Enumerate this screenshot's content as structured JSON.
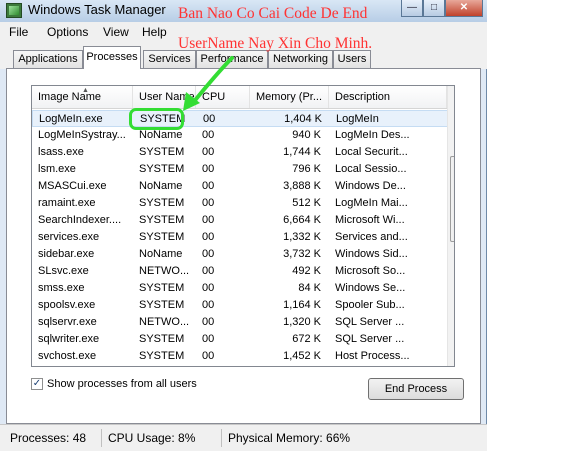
{
  "window": {
    "title": "Windows Task Manager",
    "buttons": [
      "—",
      "□",
      "✕"
    ]
  },
  "menu": [
    "File",
    "Options",
    "View",
    "Help"
  ],
  "tabs": [
    "Applications",
    "Processes",
    "Services",
    "Performance",
    "Networking",
    "Users"
  ],
  "columns": [
    "Image Name",
    "User Name",
    "CPU",
    "Memory (Pr...",
    "Description"
  ],
  "rows": [
    {
      "name": "LogMeIn.exe",
      "user": "SYSTEM",
      "cpu": "00",
      "mem": "1,404 K",
      "desc": "LogMeIn"
    },
    {
      "name": "LogMeInSystray...",
      "user": "NoName",
      "cpu": "00",
      "mem": "940 K",
      "desc": "LogMeIn Des..."
    },
    {
      "name": "lsass.exe",
      "user": "SYSTEM",
      "cpu": "00",
      "mem": "1,744 K",
      "desc": "Local Securit..."
    },
    {
      "name": "lsm.exe",
      "user": "SYSTEM",
      "cpu": "00",
      "mem": "796 K",
      "desc": "Local Sessio..."
    },
    {
      "name": "MSASCui.exe",
      "user": "NoName",
      "cpu": "00",
      "mem": "3,888 K",
      "desc": "Windows De..."
    },
    {
      "name": "ramaint.exe",
      "user": "SYSTEM",
      "cpu": "00",
      "mem": "512 K",
      "desc": "LogMeIn Mai..."
    },
    {
      "name": "SearchIndexer....",
      "user": "SYSTEM",
      "cpu": "00",
      "mem": "6,664 K",
      "desc": "Microsoft Wi..."
    },
    {
      "name": "services.exe",
      "user": "SYSTEM",
      "cpu": "00",
      "mem": "1,332 K",
      "desc": "Services and..."
    },
    {
      "name": "sidebar.exe",
      "user": "NoName",
      "cpu": "00",
      "mem": "3,732 K",
      "desc": "Windows Sid..."
    },
    {
      "name": "SLsvc.exe",
      "user": "NETWO...",
      "cpu": "00",
      "mem": "492 K",
      "desc": "Microsoft So..."
    },
    {
      "name": "smss.exe",
      "user": "SYSTEM",
      "cpu": "00",
      "mem": "84 K",
      "desc": "Windows Se..."
    },
    {
      "name": "spoolsv.exe",
      "user": "SYSTEM",
      "cpu": "00",
      "mem": "1,164 K",
      "desc": "Spooler Sub..."
    },
    {
      "name": "sqlservr.exe",
      "user": "NETWO...",
      "cpu": "00",
      "mem": "1,320 K",
      "desc": "SQL Server ..."
    },
    {
      "name": "sqlwriter.exe",
      "user": "SYSTEM",
      "cpu": "00",
      "mem": "672 K",
      "desc": "SQL Server ..."
    },
    {
      "name": "svchost.exe",
      "user": "SYSTEM",
      "cpu": "00",
      "mem": "1,452 K",
      "desc": "Host Process..."
    }
  ],
  "show_all_label": "Show processes from all users",
  "show_all_checked": "✓",
  "end_process_label": "End Process",
  "status": {
    "processes": "Processes: 48",
    "cpu": "CPU Usage: 8%",
    "memory": "Physical Memory: 66%"
  },
  "annotation": {
    "line1": "Ban Nao Co Cai Code De End",
    "line2": "UserName Nay Xin Cho Minh.",
    "color": "#ff3333",
    "highlight_color": "#33dd33"
  }
}
